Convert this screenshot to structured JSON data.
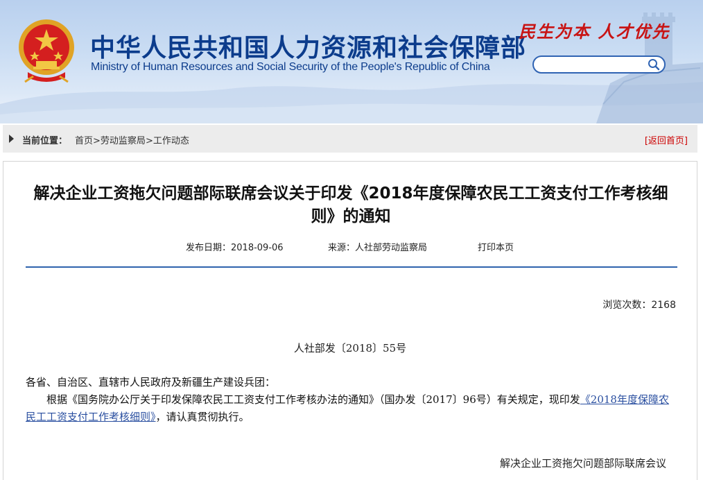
{
  "header": {
    "site_name_cn": "中华人民共和国人力资源和社会保障部",
    "site_name_en": "Ministry of Human Resources and Social Security of the People's Republic of China",
    "slogan": "民生为本 人才优先",
    "search": {
      "placeholder": "",
      "value": "",
      "icon": "search-icon"
    }
  },
  "breadcrumb": {
    "label": "当前位置：",
    "items": [
      "首页",
      "劳动监察局",
      "工作动态"
    ],
    "separator": ">",
    "back_home": "[返回首页]"
  },
  "article": {
    "title": "解决企业工资拖欠问题部际联席会议关于印发《2018年度保障农民工工资支付工作考核细则》的通知",
    "publish_date": "发布日期：2018-09-06",
    "source": "来源：人社部劳动监察局",
    "print": "打印本页",
    "views": "浏览次数：2168",
    "doc_number": "人社部发〔2018〕55号",
    "salutation": "各省、自治区、直辖市人民政府及新疆生产建设兵团：",
    "paragraph_prefix": "根据《国务院办公厅关于印发保障农民工工资支付工作考核办法的通知》（国办发〔2017〕96号）有关规定，现印发",
    "paragraph_link": "《2018年度保障农民工工资支付工作考核细则》",
    "paragraph_suffix": "，请认真贯彻执行。",
    "signature": "解决企业工资拖欠问题部际联席会议"
  },
  "colors": {
    "brand_blue": "#0c3c8c",
    "slogan_red": "#c81414",
    "rule_blue": "#2e63ad",
    "link_blue": "#2a4fa0"
  }
}
